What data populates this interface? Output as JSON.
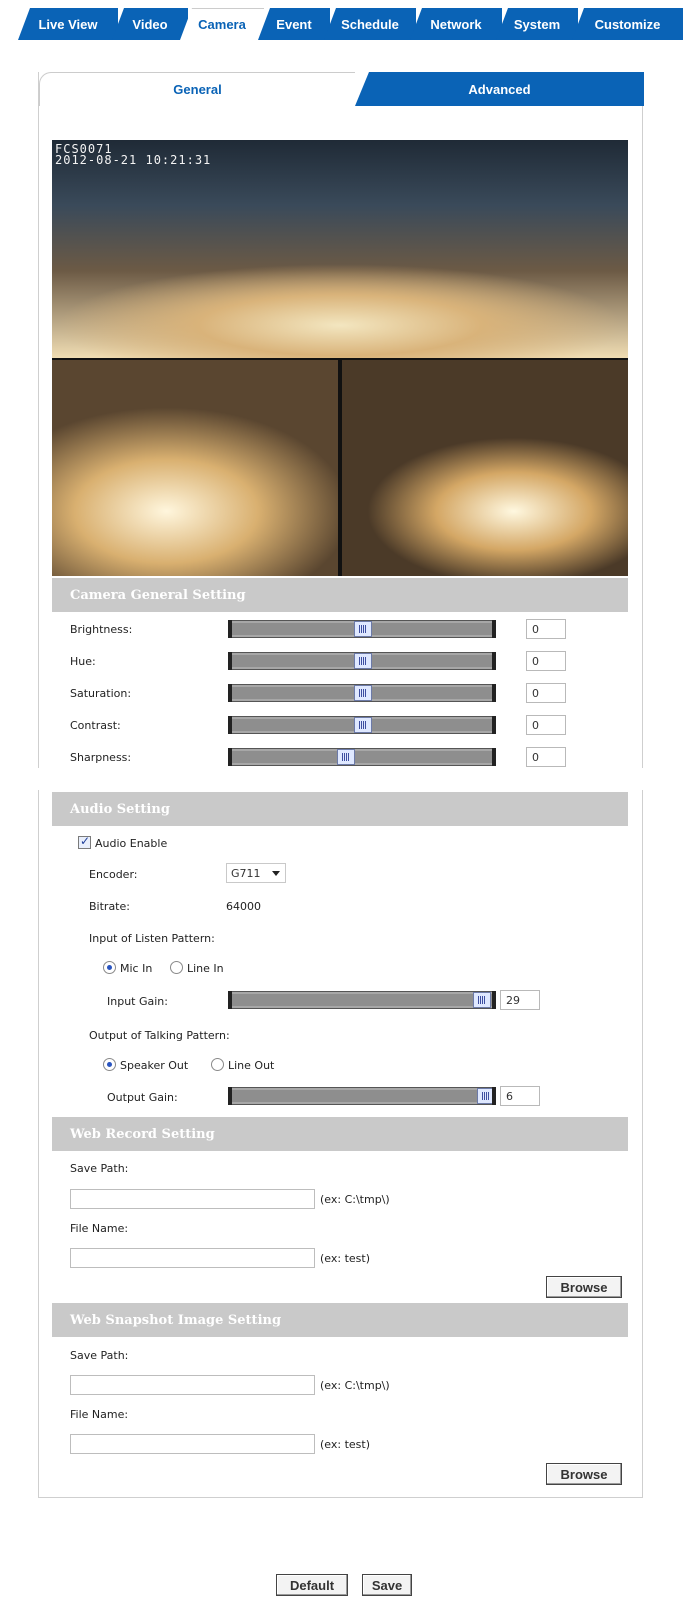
{
  "nav": {
    "tabs": [
      "Live View",
      "Video",
      "Camera",
      "Event",
      "Schedule",
      "Network",
      "System",
      "Customize"
    ],
    "active": "Camera"
  },
  "subtabs": {
    "general": "General",
    "advanced": "Advanced"
  },
  "camera": {
    "osd_line1": "FCS0071",
    "osd_line2": "2012-08-21 10:21:31"
  },
  "general_setting": {
    "title": "Camera General Setting",
    "rows": [
      {
        "label": "Brightness:",
        "value": "0",
        "level": 0.5
      },
      {
        "label": "Hue:",
        "value": "0",
        "level": 0.5
      },
      {
        "label": "Saturation:",
        "value": "0",
        "level": 0.5
      },
      {
        "label": "Contrast:",
        "value": "0",
        "level": 0.5
      },
      {
        "label": "Sharpness:",
        "value": "0",
        "level": 0.43
      }
    ]
  },
  "audio": {
    "title": "Audio Setting",
    "enable_label": "Audio Enable",
    "encoder_label": "Encoder:",
    "encoder_value": "G711",
    "bitrate_label": "Bitrate:",
    "bitrate_value": "64000",
    "input_pattern_label": "Input of Listen Pattern:",
    "mic_in": "Mic In",
    "line_in": "Line In",
    "input_gain_label": "Input Gain:",
    "input_gain_value": "29",
    "output_pattern_label": "Output of Talking Pattern:",
    "speaker_out": "Speaker Out",
    "line_out": "Line Out",
    "output_gain_label": "Output Gain:",
    "output_gain_value": "6"
  },
  "web_record": {
    "title": "Web Record Setting",
    "save_path_label": "Save Path:",
    "save_path_hint": "(ex: C:\\tmp\\)",
    "file_name_label": "File Name:",
    "file_name_hint": "(ex: test)",
    "browse": "Browse"
  },
  "web_snapshot": {
    "title": "Web Snapshot Image Setting",
    "save_path_label": "Save Path:",
    "save_path_hint": "(ex: C:\\tmp\\)",
    "file_name_label": "File Name:",
    "file_name_hint": "(ex: test)",
    "browse": "Browse"
  },
  "footer": {
    "default": "Default",
    "save": "Save"
  }
}
